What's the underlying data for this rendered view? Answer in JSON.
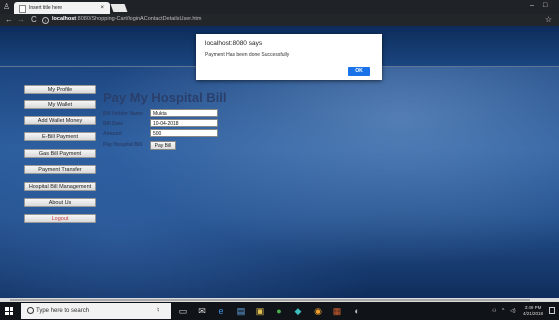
{
  "browser": {
    "tab_title": "Insert title here",
    "tab_close": "×",
    "url_host": "localhost",
    "url_rest": ":8080/Shopping-Cart/loginAContactDetailsUser.htm",
    "win_min": "–",
    "win_max": "□"
  },
  "sidebar": {
    "items": [
      {
        "label": "My Profile"
      },
      {
        "label": "My Wallet"
      },
      {
        "label": "Add Wallet Money"
      },
      {
        "label": "E-Bill Payment"
      },
      {
        "label": "Gas Bill Payment"
      },
      {
        "label": "Payment Transfer"
      },
      {
        "label": "Hospital Bill Management"
      },
      {
        "label": "About Us"
      },
      {
        "label": "Logout"
      }
    ]
  },
  "form": {
    "title": "Pay My Hospital Bill",
    "holder_label": "Bill Holder Name",
    "holder_value": "Mukta",
    "date_label": "Bill Date",
    "date_value": "10-04-2018",
    "amount_label": "Amount",
    "amount_value": "500",
    "pay_label": "Pay Hospital Bill",
    "pay_button": "Pay Bill"
  },
  "dialog": {
    "title": "localhost:8080 says",
    "message": "Payment Has been done Successfully",
    "ok_label": "OK"
  },
  "taskbar": {
    "search_placeholder": "Type here to search",
    "time": "3:49 PM",
    "date": "4/21/2018"
  },
  "icons": {
    "accent": "#1a73e8"
  }
}
